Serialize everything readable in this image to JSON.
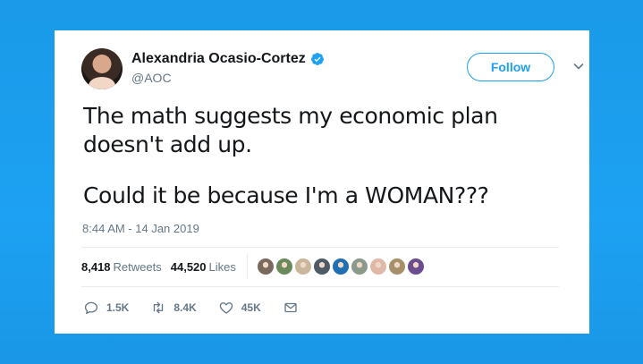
{
  "tweet": {
    "author": {
      "display_name": "Alexandria Ocasio-Cortez",
      "handle": "@AOC",
      "verified": true
    },
    "follow_label": "Follow",
    "text_lines": [
      "The math suggests my economic plan doesn't add up.",
      "Could it be because I'm a WOMAN???"
    ],
    "timestamp": "8:44 AM - 14 Jan 2019",
    "stats": {
      "retweets_count": "8,418",
      "retweets_label": "Retweets",
      "likes_count": "44,520",
      "likes_label": "Likes"
    },
    "likers": [
      {
        "color": "#7a6a5e"
      },
      {
        "color": "#6b8a5b"
      },
      {
        "color": "#c9b79b"
      },
      {
        "color": "#4e5b66"
      },
      {
        "color": "#1f6fb2"
      },
      {
        "color": "#8c9a8e"
      },
      {
        "color": "#e0b8a8"
      },
      {
        "color": "#a78f6a"
      },
      {
        "color": "#6b4c8f"
      }
    ],
    "actions": {
      "reply_count": "1.5K",
      "retweet_count": "8.4K",
      "like_count": "45K"
    }
  },
  "colors": {
    "background": "#1da1f2",
    "accent": "#1da1f2",
    "text_primary": "#14171a",
    "text_secondary": "#657786",
    "divider": "#e6ecf0"
  }
}
